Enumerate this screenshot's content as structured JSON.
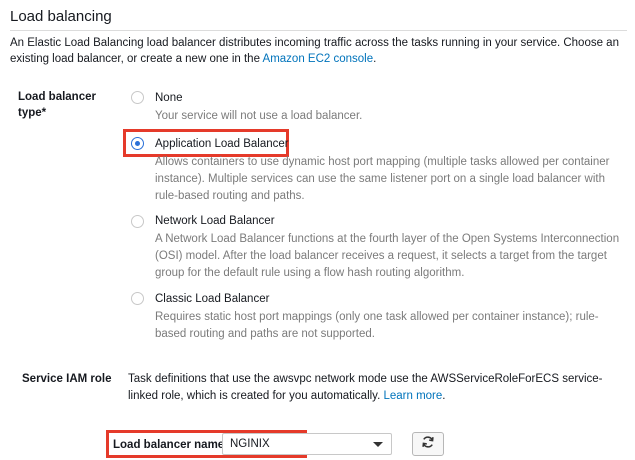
{
  "section": {
    "title": "Load balancing",
    "intro_text": "An Elastic Load Balancing load balancer distributes incoming traffic across the tasks running in your service. Choose an existing load balancer, or create a new one in the ",
    "intro_link": "Amazon EC2 console",
    "intro_end": "."
  },
  "load_balancer_type": {
    "label": "Load balancer type*",
    "selected": "Application Load Balancer",
    "options": [
      {
        "label": "None",
        "description": "Your service will not use a load balancer."
      },
      {
        "label": "Application Load Balancer",
        "description": "Allows containers to use dynamic host port mapping (multiple tasks allowed per container instance). Multiple services can use the same listener port on a single load balancer with rule-based routing and paths."
      },
      {
        "label": "Network Load Balancer",
        "description": "A Network Load Balancer functions at the fourth layer of the Open Systems Interconnection (OSI) model. After the load balancer receives a request, it selects a target from the target group for the default rule using a flow hash routing algorithm."
      },
      {
        "label": "Classic Load Balancer",
        "description": "Requires static host port mappings (only one task allowed per container instance); rule-based routing and paths are not supported."
      }
    ]
  },
  "service_iam_role": {
    "label": "Service IAM role",
    "text": "Task definitions that use the awsvpc network mode use the AWSServiceRoleForECS service-linked role, which is created for you automatically. ",
    "link": "Learn more",
    "end": "."
  },
  "load_balancer_name": {
    "label": "Load balancer name",
    "value": "NGINIX"
  },
  "icons": {
    "select_caret": "caret-down-icon",
    "refresh": "refresh-icon"
  },
  "colors": {
    "link": "#0073bb",
    "radio_selected": "#2a70d8",
    "highlight": "#e53a2a",
    "description_text": "#7b7b7b"
  }
}
